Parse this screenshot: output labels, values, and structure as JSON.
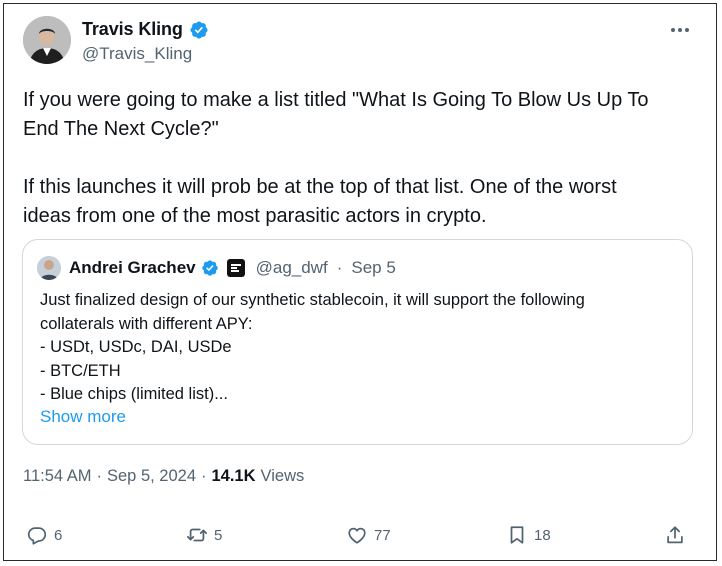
{
  "author": {
    "display_name": "Travis Kling",
    "handle": "@Travis_Kling",
    "verified": true
  },
  "tweet": {
    "text": "If you were going to make a list titled \"What Is Going To Blow Us Up To\nEnd The Next Cycle?\"\n\nIf this launches it will prob be at the top of that list. One of the worst\nideas from one of the most parasitic actors in crypto."
  },
  "quoted": {
    "display_name": "Andrei Grachev",
    "handle": "@ag_dwf",
    "separator": "·",
    "date": "Sep 5",
    "lines": [
      "Just finalized design of our synthetic stablecoin, it will support the following",
      "collaterals with different APY:",
      "- USDt, USDc, DAI, USDe",
      "- BTC/ETH",
      "- Blue chips (limited list)..."
    ],
    "show_more": "Show more"
  },
  "meta": {
    "time": "11:54 AM",
    "sep1": "·",
    "date": "Sep 5, 2024",
    "sep2": "·",
    "views_count": "14.1K",
    "views_label": "Views"
  },
  "actions": {
    "replies": "6",
    "reposts": "5",
    "likes": "77",
    "bookmarks": "18"
  },
  "colors": {
    "verified": "#1d9bf0",
    "link": "#1d9bf0",
    "secondary_text": "#536471",
    "border": "#cfd9de"
  }
}
